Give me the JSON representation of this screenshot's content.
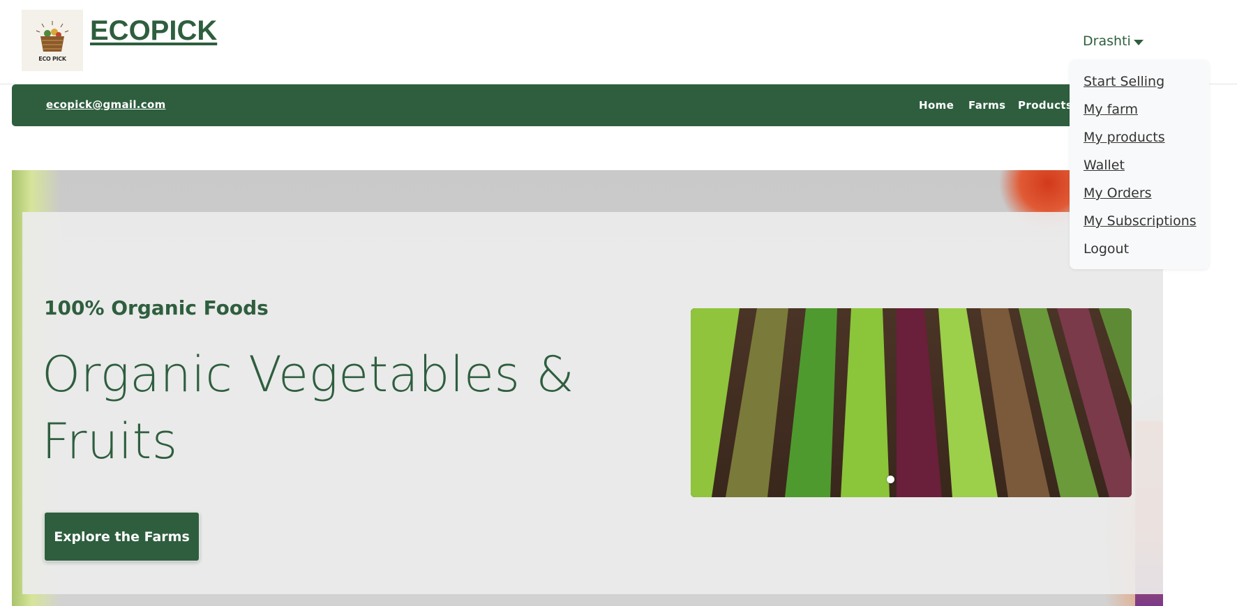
{
  "brand": {
    "name": "ECOPICK",
    "logo_caption": "ECO PICK"
  },
  "user": {
    "name": "Drashti",
    "caret_icon": "caret-down-icon"
  },
  "navbar": {
    "email": "ecopick@gmail.com",
    "links": [
      "Home",
      "Farms",
      "Products"
    ]
  },
  "dropdown": {
    "items": [
      "Start Selling",
      "My farm",
      "My products",
      "Wallet",
      "My Orders",
      "My Subscriptions",
      "Logout"
    ]
  },
  "hero": {
    "eyebrow": "100% Organic Foods",
    "headline_line1": "Organic Vegetables &",
    "headline_line2": "Fruits",
    "cta_label": "Explore the Farms"
  },
  "colors": {
    "brand_green": "#2e5e3e",
    "dropdown_bg": "#f8f9fa"
  }
}
